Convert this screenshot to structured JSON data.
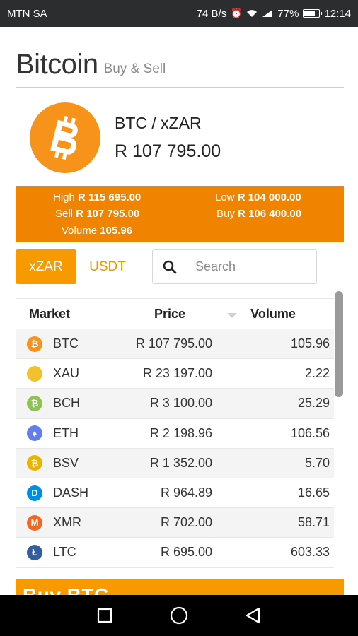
{
  "status_bar": {
    "carrier": "MTN SA",
    "speed": "74 B/s",
    "battery": "77%",
    "time": "12:14"
  },
  "header": {
    "title": "Bitcoin",
    "subtitle": "Buy & Sell"
  },
  "ticker": {
    "pair": "BTC / xZAR",
    "price": "R 107 795.00"
  },
  "stats": {
    "high_label": "High",
    "high_value": "R 115 695.00",
    "low_label": "Low",
    "low_value": "R 104 000.00",
    "sell_label": "Sell",
    "sell_value": "R 107 795.00",
    "buy_label": "Buy",
    "buy_value": "R 106 400.00",
    "volume_label": "Volume",
    "volume_value": "105.96"
  },
  "tabs": [
    {
      "label": "xZAR",
      "active": true
    },
    {
      "label": "USDT",
      "active": false
    }
  ],
  "search": {
    "placeholder": "Search",
    "value": ""
  },
  "table": {
    "headers": {
      "market": "Market",
      "price": "Price",
      "volume": "Volume"
    },
    "rows": [
      {
        "code": "BTC",
        "price": "R 107 795.00",
        "volume": "105.96",
        "icon": "bitcoin-icon",
        "color": "#f7931a"
      },
      {
        "code": "XAU",
        "price": "R 23 197.00",
        "volume": "2.22",
        "icon": "gold-coins-icon",
        "color": "#f2c12e"
      },
      {
        "code": "BCH",
        "price": "R 3 100.00",
        "volume": "25.29",
        "icon": "bitcoin-cash-icon",
        "color": "#8dc351"
      },
      {
        "code": "ETH",
        "price": "R 2 198.96",
        "volume": "106.56",
        "icon": "ethereum-icon",
        "color": "#627eea"
      },
      {
        "code": "BSV",
        "price": "R 1 352.00",
        "volume": "5.70",
        "icon": "bitcoin-sv-icon",
        "color": "#eab300"
      },
      {
        "code": "DASH",
        "price": "R 964.89",
        "volume": "16.65",
        "icon": "dash-icon",
        "color": "#008de4"
      },
      {
        "code": "XMR",
        "price": "R 702.00",
        "volume": "58.71",
        "icon": "monero-icon",
        "color": "#f26822"
      },
      {
        "code": "LTC",
        "price": "R 695.00",
        "volume": "603.33",
        "icon": "litecoin-icon",
        "color": "#345d9d"
      }
    ]
  },
  "buy_banner": {
    "label": "Buy BTC"
  },
  "colors": {
    "accent": "#f79a00",
    "stats_bg": "#f08400"
  }
}
